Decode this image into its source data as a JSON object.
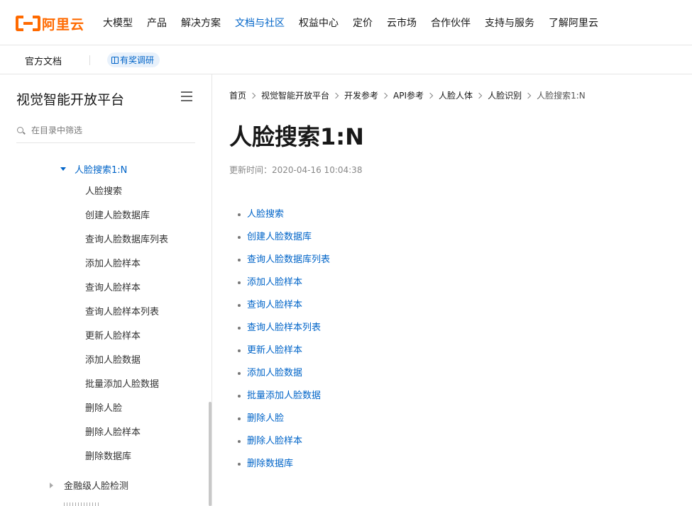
{
  "brand": {
    "logo_text": "阿里云",
    "accent": "#ff6a00",
    "link": "#0064c8"
  },
  "topnav": {
    "items": [
      {
        "label": "大模型"
      },
      {
        "label": "产品"
      },
      {
        "label": "解决方案"
      },
      {
        "label": "文档与社区"
      },
      {
        "label": "权益中心"
      },
      {
        "label": "定价"
      },
      {
        "label": "云市场"
      },
      {
        "label": "合作伙伴"
      },
      {
        "label": "支持与服务"
      },
      {
        "label": "了解阿里云"
      }
    ],
    "active_index": 3
  },
  "subnav": {
    "docs_label": "官方文档",
    "survey_label": "有奖调研",
    "survey_icon": "gift-icon"
  },
  "sidebar": {
    "title": "视觉智能开放平台",
    "menu_icon": "hamburger-icon",
    "filter_placeholder": "在目录中筛选",
    "active_item": "人脸搜索1:N",
    "items": [
      {
        "label": "人脸搜索"
      },
      {
        "label": "创建人脸数据库"
      },
      {
        "label": "查询人脸数据库列表"
      },
      {
        "label": "添加人脸样本"
      },
      {
        "label": "查询人脸样本"
      },
      {
        "label": "查询人脸样本列表"
      },
      {
        "label": "更新人脸样本"
      },
      {
        "label": "添加人脸数据"
      },
      {
        "label": "批量添加人脸数据"
      },
      {
        "label": "删除人脸"
      },
      {
        "label": "删除人脸样本"
      },
      {
        "label": "删除数据库"
      }
    ],
    "next_item": "金融级人脸检测"
  },
  "content": {
    "breadcrumb": [
      {
        "label": "首页"
      },
      {
        "label": "视觉智能开放平台"
      },
      {
        "label": "开发参考"
      },
      {
        "label": "API参考"
      },
      {
        "label": "人脸人体"
      },
      {
        "label": "人脸识别"
      },
      {
        "label": "人脸搜索1:N"
      }
    ],
    "title": "人脸搜索1:N",
    "updated": "更新时间：2020-04-16 10:04:38",
    "links": [
      {
        "label": "人脸搜索"
      },
      {
        "label": "创建人脸数据库"
      },
      {
        "label": "查询人脸数据库列表"
      },
      {
        "label": "添加人脸样本"
      },
      {
        "label": "查询人脸样本"
      },
      {
        "label": "查询人脸样本列表"
      },
      {
        "label": "更新人脸样本"
      },
      {
        "label": "添加人脸数据"
      },
      {
        "label": "批量添加人脸数据"
      },
      {
        "label": "删除人脸"
      },
      {
        "label": "删除人脸样本"
      },
      {
        "label": "删除数据库"
      }
    ]
  }
}
